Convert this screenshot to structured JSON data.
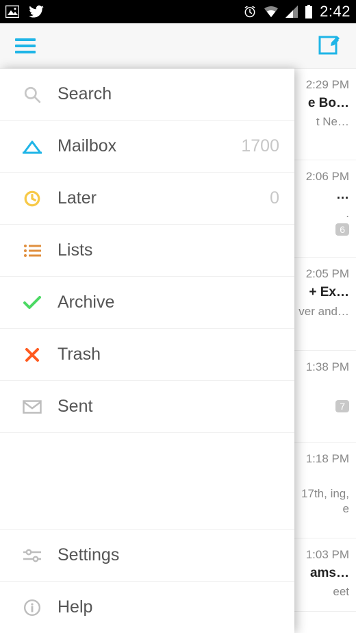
{
  "status": {
    "time": "2:42"
  },
  "toolbar": {},
  "sidebar": {
    "search": {
      "label": "Search"
    },
    "mailbox": {
      "label": "Mailbox",
      "count": "1700"
    },
    "later": {
      "label": "Later",
      "count": "0"
    },
    "lists": {
      "label": "Lists"
    },
    "archive": {
      "label": "Archive"
    },
    "trash": {
      "label": "Trash"
    },
    "sent": {
      "label": "Sent"
    },
    "settings": {
      "label": "Settings"
    },
    "help": {
      "label": "Help"
    }
  },
  "emails": [
    {
      "time": "2:29 PM",
      "title": "e Bo…",
      "sub": "t Ne…",
      "badge": ""
    },
    {
      "time": "2:06 PM",
      "title": "…",
      "sub": ".",
      "badge": "6"
    },
    {
      "time": "2:05 PM",
      "title": "+ Ex…",
      "sub": "ver and…",
      "badge": ""
    },
    {
      "time": "1:38 PM",
      "title": "",
      "sub": "",
      "badge": "7"
    },
    {
      "time": "1:18 PM",
      "title": "",
      "sub": "17th, ing, e",
      "badge": ""
    },
    {
      "time": "1:03 PM",
      "title": "ams…",
      "sub": "eet",
      "badge": ""
    }
  ]
}
